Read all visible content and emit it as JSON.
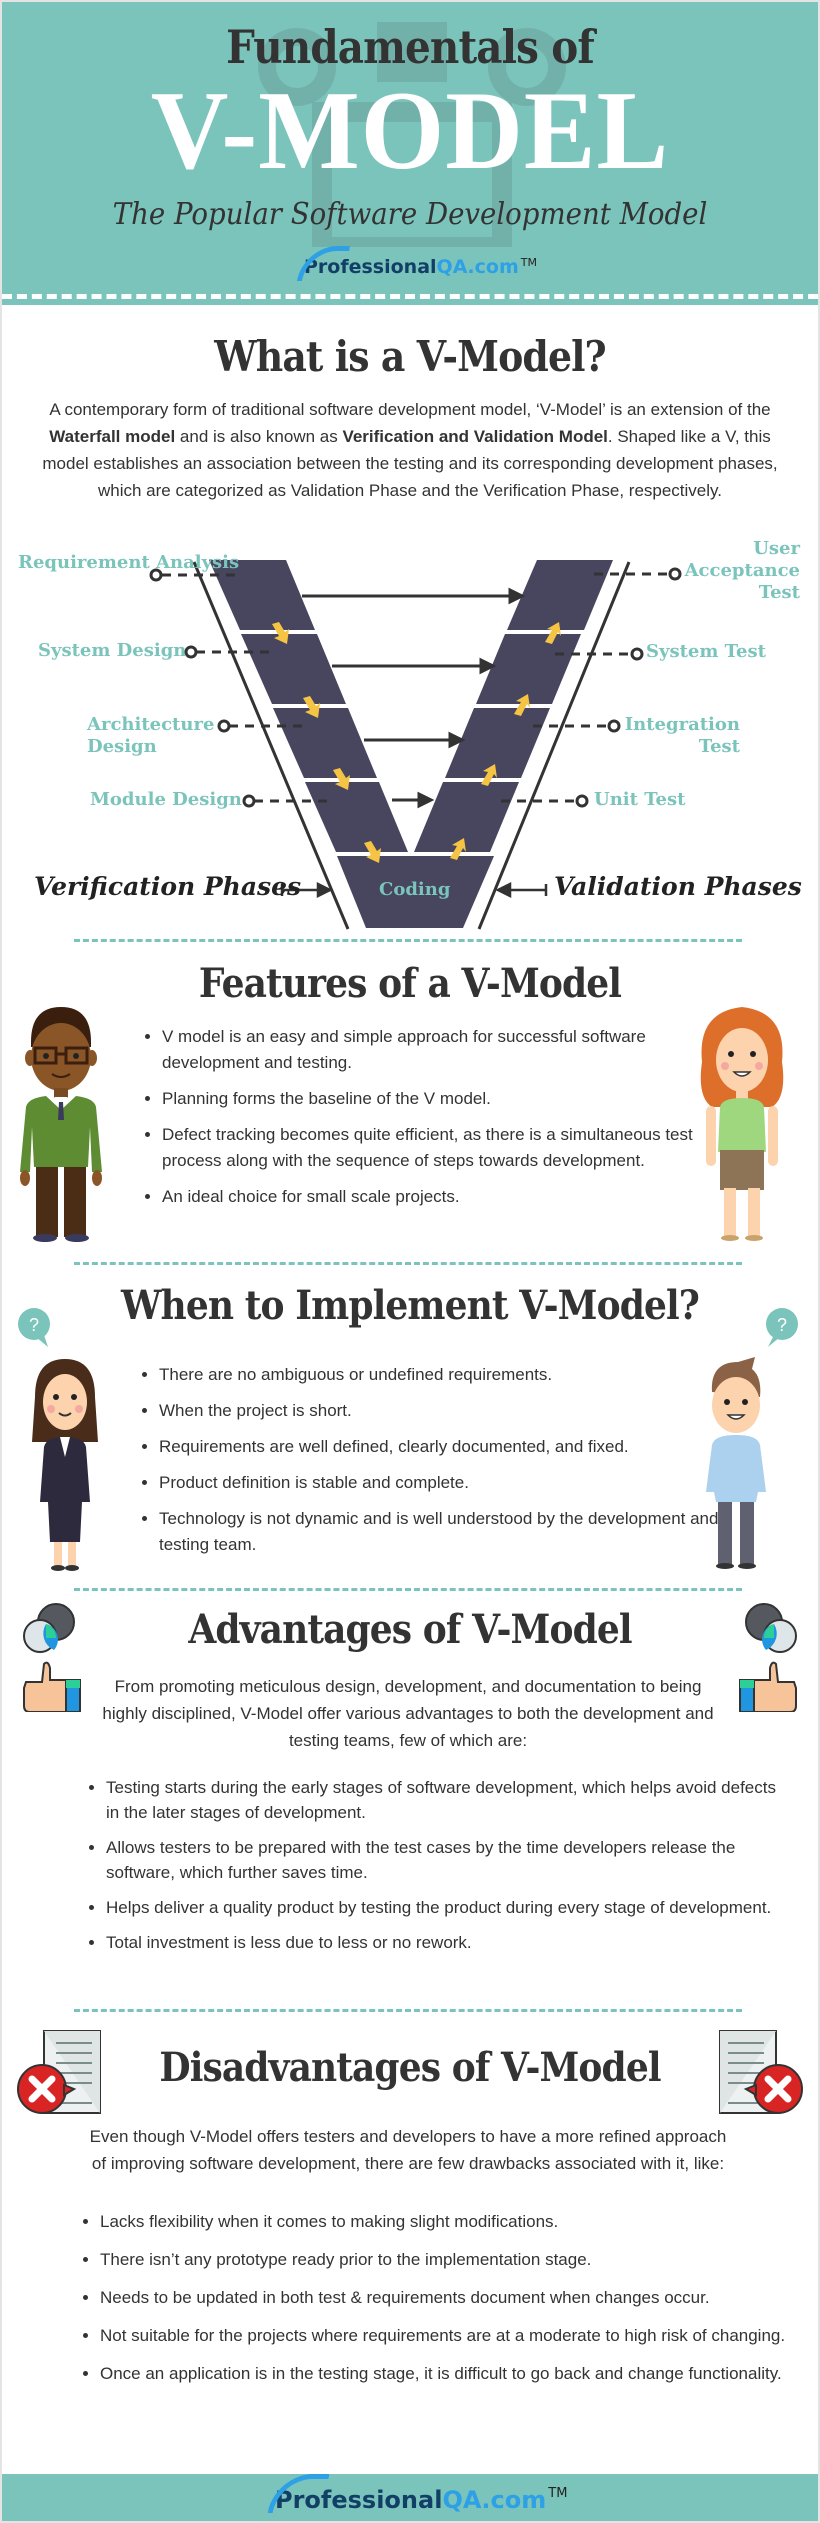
{
  "header": {
    "title_line1": "Fundamentals of",
    "title_line2": "V-MODEL",
    "subtitle": "The Popular Software Development Model",
    "logo": {
      "part1": "Professional",
      "part2": "QA",
      "part3": ".com",
      "tm": "TM"
    }
  },
  "colors": {
    "teal": "#7bc4bc",
    "dark": "#333333",
    "v_fill": "#47465e",
    "arrow_yellow": "#f6c444",
    "logo_navy": "#123f66",
    "logo_blue": "#2da0e6"
  },
  "what_is": {
    "heading": "What is a V-Model?",
    "paragraph": {
      "t1": "A contemporary form of traditional software development model, ‘V-Model’ is an extension of the ",
      "b1": "Waterfall model",
      "t2": " and is also known as ",
      "b2": "Verification and Validation Model",
      "t3": ". Shaped like a V, this model establishes an association between the testing and its corresponding development phases, which are categorized as Validation Phase and the Verification Phase, respectively."
    }
  },
  "diagram": {
    "verification_phases": [
      "Requirement Analysis",
      "System Design",
      "Architecture Design",
      "Module Design"
    ],
    "validation_phases": [
      "User Acceptance Test",
      "System Test",
      "Integration Test",
      "Unit Test"
    ],
    "bottom": "Coding",
    "left_caption": "Verification Phases",
    "right_caption": "Validation Phases"
  },
  "features": {
    "heading": "Features of a V-Model",
    "items": [
      "V model is an easy and simple approach for successful software development and testing.",
      "Planning forms the baseline of the V model.",
      "Defect tracking becomes quite efficient, as there is a simultaneous test process along with the sequence of steps towards development.",
      "An ideal choice for small scale projects."
    ]
  },
  "when": {
    "heading": "When to Implement V-Model?",
    "bubble": "?",
    "items": [
      "There are no ambiguous or undefined requirements.",
      "When the project is short.",
      "Requirements are well defined, clearly documented, and fixed.",
      "Product definition is stable and complete.",
      "Technology is not dynamic and is well understood by the development and testing team."
    ]
  },
  "advantages": {
    "heading": "Advantages of V-Model",
    "intro": "From promoting meticulous design, development, and documentation to being highly disciplined, V-Model offer various advantages to both the development and testing teams, few of which are:",
    "items": [
      " Testing starts during the early stages of software development, which helps avoid defects in the later stages of development.",
      "Allows testers to be prepared with the test cases by the time developers release the software, which further saves time.",
      "Helps deliver a quality product by testing the product during every stage of development.",
      "Total investment is less due to less or no rework."
    ]
  },
  "disadvantages": {
    "heading": "Disadvantages of V-Model",
    "intro": "Even though V-Model offers testers and developers to have a more refined approach of improving software development, there are few drawbacks associated with it, like:",
    "items": [
      "Lacks flexibility when it comes to making slight modifications.",
      "There isn’t any prototype ready prior to the implementation stage.",
      "Needs to be updated in both test & requirements document when changes occur.",
      "Not suitable for the projects where requirements are at a moderate to high risk of changing.",
      "Once an application is in the testing stage, it is difficult to go back and change functionality."
    ]
  },
  "footer": {
    "logo": {
      "part1": "Professional",
      "part2": "QA",
      "part3": ".com",
      "tm": "TM"
    }
  }
}
